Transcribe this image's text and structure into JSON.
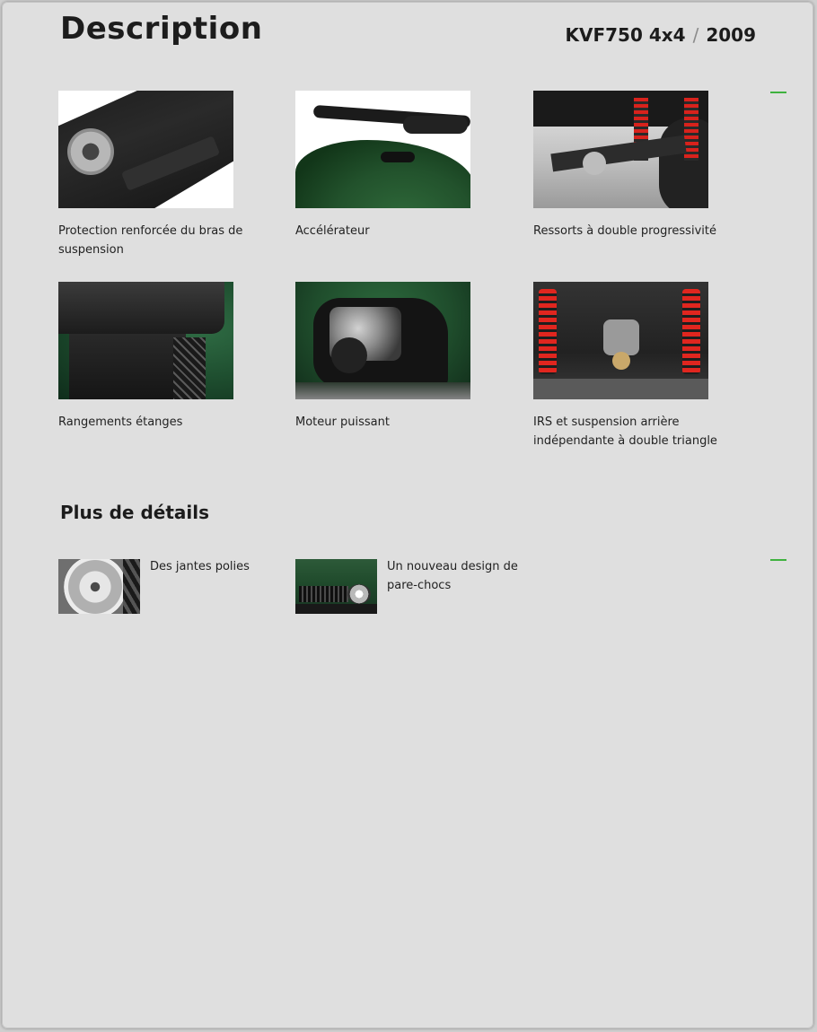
{
  "header": {
    "title": "Description",
    "model": "KVF750 4x4",
    "separator": "/",
    "year": "2009"
  },
  "features": [
    {
      "caption": "Protection renforcée du bras de suspension",
      "image": "swing-arm-protection-photo"
    },
    {
      "caption": "Accélérateur",
      "image": "throttle-photo"
    },
    {
      "caption": "Ressorts à double progressivité",
      "image": "rear-shocks-photo"
    },
    {
      "caption": "Rangements étanges",
      "image": "storage-box-photo"
    },
    {
      "caption": "Moteur puissant",
      "image": "engine-photo"
    },
    {
      "caption": "IRS et  suspension arrière indépendante à double triangle",
      "image": "irs-suspension-photo"
    }
  ],
  "details_section": {
    "title": "Plus de détails",
    "items": [
      {
        "caption": "Des jantes polies",
        "image": "polished-rim-photo"
      },
      {
        "caption": "Un nouveau design de pare-chocs",
        "image": "bumper-photo"
      }
    ]
  },
  "colors": {
    "accent_green": "#3fb23f",
    "page_background": "#dfdfdf",
    "text": "#1c1c1c"
  }
}
